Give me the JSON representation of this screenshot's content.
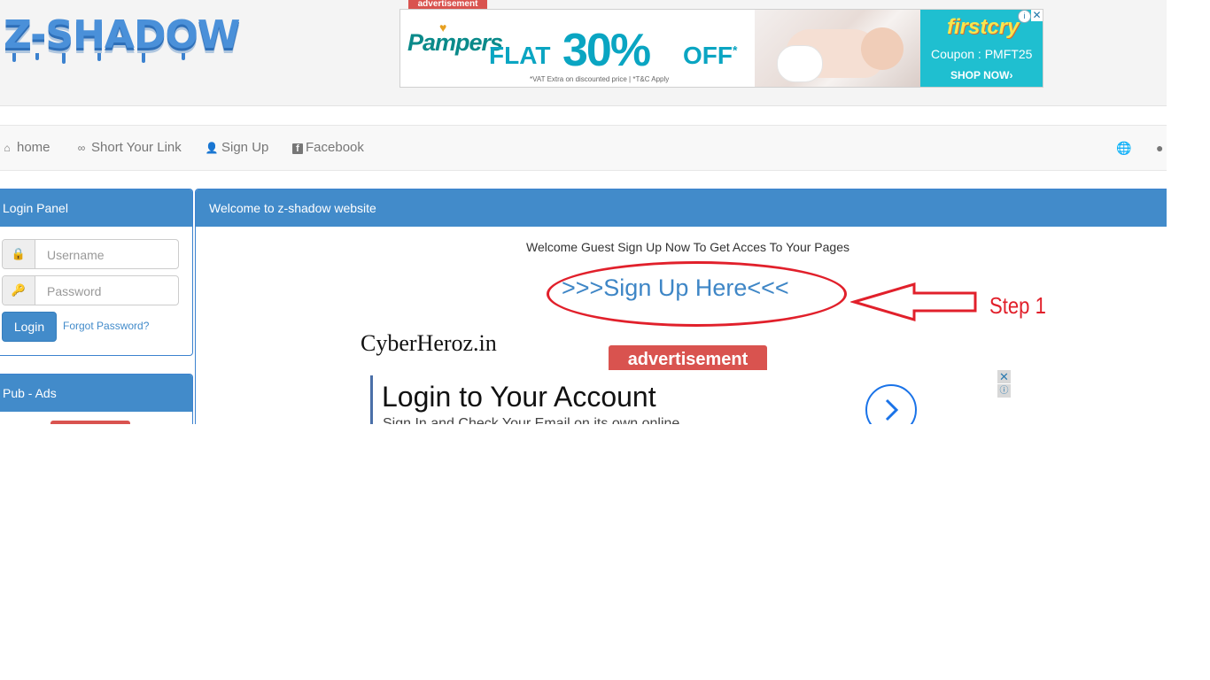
{
  "brand": {
    "logo_text": "Z-SHADOW"
  },
  "top_ad": {
    "badge": "advertisement",
    "pampers": "Pampers",
    "flat": "FLAT",
    "percent": "30%",
    "off": "OFF",
    "asterisk": "*",
    "terms": "*VAT Extra on discounted price | *T&C Apply",
    "firstcry": "firstcry",
    "coupon": "Coupon : PMFT25",
    "shop_now": "SHOP NOW"
  },
  "nav": {
    "items": [
      {
        "label": "home",
        "icon": "home-icon"
      },
      {
        "label": "Short Your Link",
        "icon": "link-icon"
      },
      {
        "label": "Sign Up",
        "icon": "user-plus-icon"
      },
      {
        "label": "Facebook",
        "icon": "facebook-icon"
      }
    ],
    "right_icons": [
      "globe-icon",
      "tint-icon"
    ]
  },
  "login_panel": {
    "title": "Login Panel",
    "username_placeholder": "Username",
    "password_placeholder": "Password",
    "login_label": "Login",
    "forgot_label": "Forgot Password?"
  },
  "pub_panel": {
    "title": "Pub - Ads"
  },
  "main_panel": {
    "title": "Welcome to z-shadow website",
    "welcome_text": "Welcome Guest Sign Up Now To Get Acces To Your Pages",
    "signup_link": ">>>Sign Up Here<<<"
  },
  "annotation": {
    "step": "Step 1",
    "watermark": "CyberHeroz.in"
  },
  "mid_ad": {
    "badge": "advertisement",
    "title": "Login to Your Account",
    "subtitle": "Sign In and Check Your Email on its own online"
  }
}
